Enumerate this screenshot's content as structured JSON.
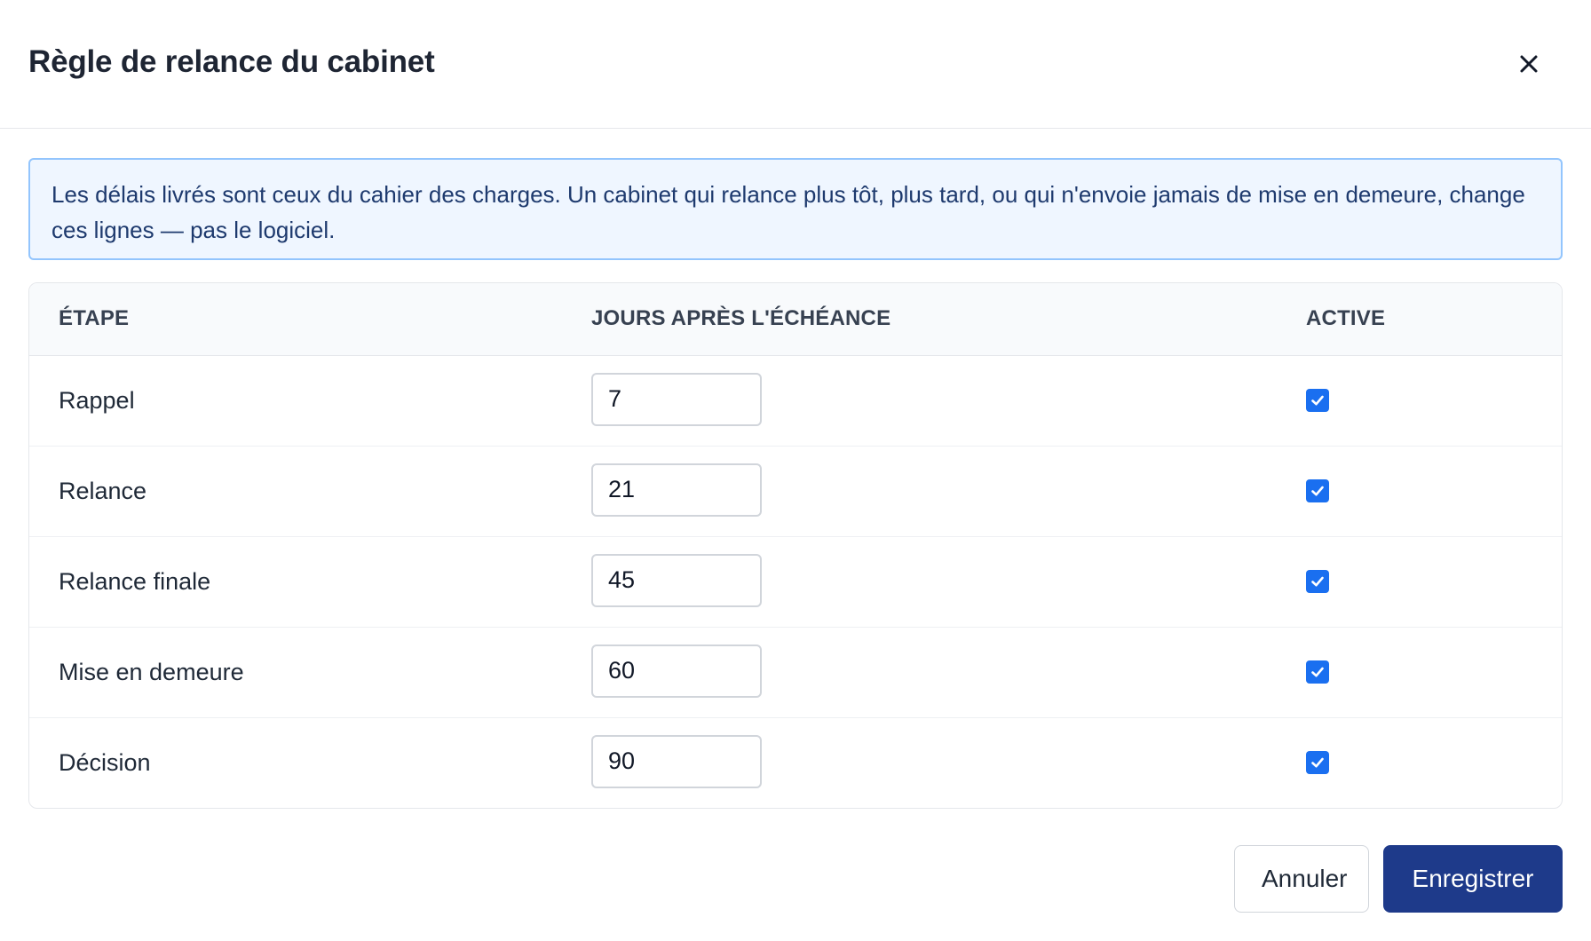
{
  "dialog": {
    "title": "Règle de relance du cabinet",
    "close_icon": "close-icon"
  },
  "info": {
    "text": "Les délais livrés sont ceux du cahier des charges. Un cabinet qui relance plus tôt, plus tard, ou qui n'envoie jamais de mise en demeure, change ces lignes — pas le logiciel."
  },
  "table": {
    "headers": {
      "step": "ÉTAPE",
      "days": "JOURS APRÈS L'ÉCHÉANCE",
      "active": "ACTIVE"
    },
    "rows": [
      {
        "step": "Rappel",
        "days": "7",
        "active": true
      },
      {
        "step": "Relance",
        "days": "21",
        "active": true
      },
      {
        "step": "Relance finale",
        "days": "45",
        "active": true
      },
      {
        "step": "Mise en demeure",
        "days": "60",
        "active": true
      },
      {
        "step": "Décision",
        "days": "90",
        "active": true
      }
    ]
  },
  "footer": {
    "cancel_label": "Annuler",
    "save_label": "Enregistrer"
  },
  "colors": {
    "primary": "#1e3a8a",
    "checkbox": "#1a6ff0",
    "info_bg": "#eff6ff",
    "info_border": "#93c5fd"
  }
}
